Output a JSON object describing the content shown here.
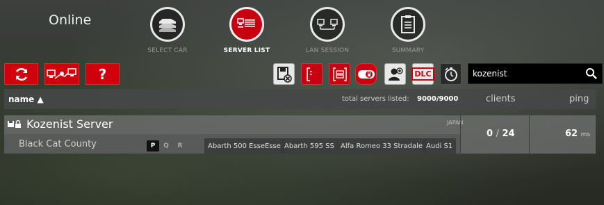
{
  "header": {
    "title": "Online",
    "steps": [
      {
        "label": "SELECT CAR",
        "icon": "cars-icon"
      },
      {
        "label": "SERVER LIST",
        "icon": "server-list-icon",
        "active": true
      },
      {
        "label": "LAN SESSION",
        "icon": "lan-icon"
      },
      {
        "label": "SUMMARY",
        "icon": "clipboard-icon"
      }
    ]
  },
  "toolbar": {
    "refresh_icon": "refresh-icon",
    "network_icon": "network-icon",
    "help_label": "?",
    "dlc_label": "DLC"
  },
  "search": {
    "value": "kozenist",
    "placeholder": ""
  },
  "list_header": {
    "name_label": "name",
    "sort_indicator": "▲",
    "total_label": "total servers listed:",
    "total_count": "9000/9000",
    "clients_label": "clients",
    "ping_label": "ping"
  },
  "servers": [
    {
      "name": "Kozenist Server",
      "country": "JAPAN",
      "track": "Black Cat County",
      "sessions": [
        "P",
        "Q",
        "R"
      ],
      "cars": [
        "Abarth 500 EsseEsse",
        "Abarth 595 SS",
        "Alfa Romeo 33 Stradale",
        "Audi S1"
      ],
      "clients": "0",
      "clients_sep": "/",
      "max_clients": "24",
      "ping": "62",
      "ping_unit": "ms"
    }
  ],
  "colors": {
    "accent": "#c8000f"
  }
}
